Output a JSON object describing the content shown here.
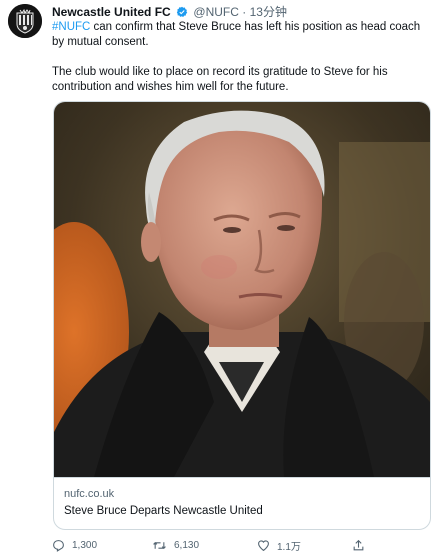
{
  "author": {
    "name": "Newcastle United FC",
    "handle": "@NUFC",
    "separator": "·",
    "time": "13分钟"
  },
  "tweet": {
    "hashtag": "#NUFC",
    "line1_rest": " can confirm that Steve Bruce has left his position as head coach by mutual consent.",
    "paragraph2": "The club would like to place on record its gratitude to Steve for his contribution and wishes him well for the future."
  },
  "card": {
    "domain": "nufc.co.uk",
    "title": "Steve Bruce Departs Newcastle United"
  },
  "actions": {
    "replies": "1,300",
    "retweets": "6,130",
    "likes": "1.1万"
  },
  "colors": {
    "link": "#1d9bf0",
    "secondary_text": "#536471",
    "border": "#cfd9de",
    "verified": "#1d9bf0"
  },
  "icons": [
    "newcastle-crest-icon",
    "verified-badge-icon",
    "reply-icon",
    "retweet-icon",
    "like-icon",
    "share-icon"
  ]
}
